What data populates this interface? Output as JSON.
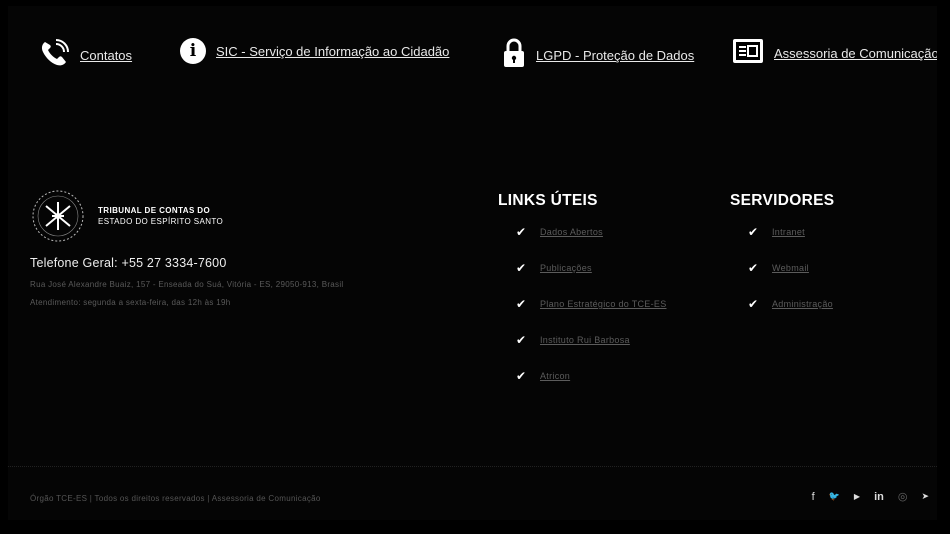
{
  "topnav": {
    "items": [
      {
        "label": "Contatos",
        "icon": "phone-icon"
      },
      {
        "label": "SIC - Serviço de Informação ao Cidadão",
        "icon": "info-icon",
        "icon_text": "i"
      },
      {
        "label": "LGPD - Proteção de Dados",
        "icon": "lock-icon"
      },
      {
        "label": "Assessoria de Comunicação",
        "icon": "newspaper-icon"
      }
    ]
  },
  "brand": {
    "name_line1": "TRIBUNAL DE CONTAS DO",
    "name_line2": "ESTADO DO ESPÍRITO SANTO"
  },
  "contact": {
    "phone": "Telefone Geral: +55 27 3334-7600",
    "address_line1": "Rua José Alexandre Buaiz, 157 - Enseada do Suá, Vitória - ES, 29050-913, Brasil",
    "address_line2": "Atendimento: segunda a sexta-feira, das 12h às 19h"
  },
  "links_uteis": {
    "title": "LINKS ÚTEIS",
    "items": [
      "Dados Abertos",
      "Publicações",
      "Plano Estratégico do TCE-ES",
      "Instituto Rui Barbosa",
      "Atricon"
    ]
  },
  "servidores": {
    "title": "SERVIDORES",
    "items": [
      "Intranet",
      "Webmail",
      "Administração"
    ]
  },
  "footer": {
    "copyright": "Órgão TCE-ES | Todos os direitos reservados | Assessoria de Comunicação"
  },
  "social": {
    "items": [
      {
        "icon": "facebook-icon",
        "glyph": "f"
      },
      {
        "icon": "twitter-icon",
        "glyph": "🐦"
      },
      {
        "icon": "youtube-icon",
        "glyph": "▶"
      },
      {
        "icon": "linkedin-icon",
        "glyph": "in"
      },
      {
        "icon": "instagram-icon",
        "glyph": "◎"
      },
      {
        "icon": "telegram-icon",
        "glyph": "➤"
      }
    ]
  },
  "colors": {
    "background": "#050505",
    "text": "#ffffff",
    "muted": "#5a5a5a"
  }
}
